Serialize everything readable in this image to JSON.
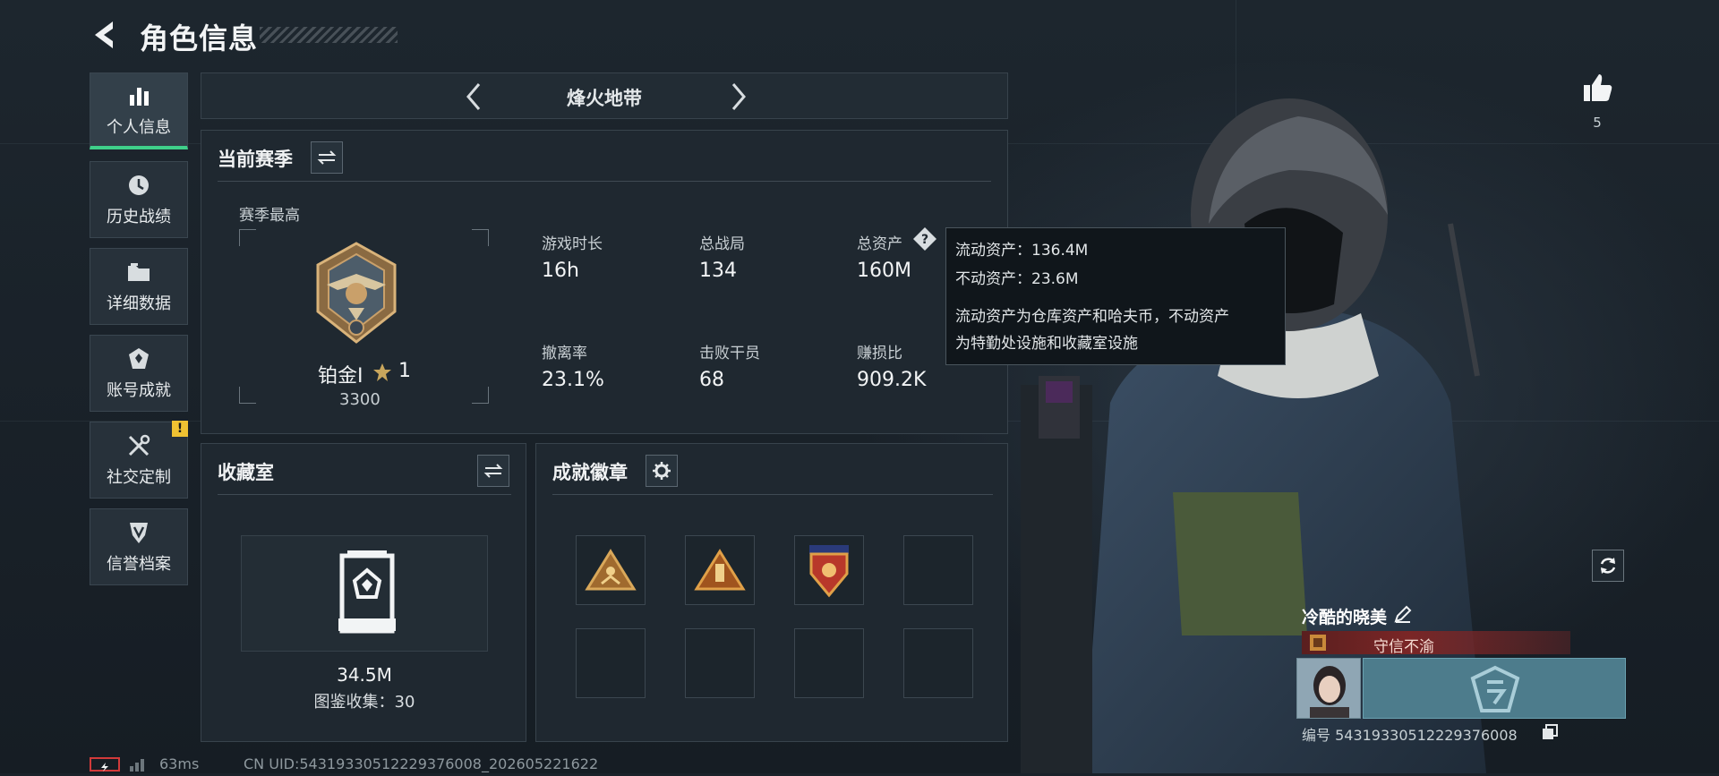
{
  "header": {
    "title": "角色信息"
  },
  "sidebar": {
    "items": [
      {
        "label": "个人信息",
        "icon": "bar-chart-icon",
        "active": true
      },
      {
        "label": "历史战绩",
        "icon": "history-icon"
      },
      {
        "label": "详细数据",
        "icon": "folder-icon"
      },
      {
        "label": "账号成就",
        "icon": "achievement-icon"
      },
      {
        "label": "社交定制",
        "icon": "tools-icon",
        "badge": "!"
      },
      {
        "label": "信誉档案",
        "icon": "shield-icon"
      }
    ]
  },
  "mode_selector": {
    "label": "烽火地带"
  },
  "current_season": {
    "title": "当前赛季",
    "season_best_label": "赛季最高",
    "rank_name": "铂金I",
    "rank_stars": "1",
    "rank_score": "3300",
    "stats": [
      {
        "label": "游戏时长",
        "value": "16h"
      },
      {
        "label": "总战局",
        "value": "134"
      },
      {
        "label": "总资产",
        "value": "160M"
      },
      {
        "label": "撤离率",
        "value": "23.1%"
      },
      {
        "label": "击败干员",
        "value": "68"
      },
      {
        "label": "赚损比",
        "value": "909.2K"
      }
    ]
  },
  "tooltip": {
    "line1": "流动资产：136.4M",
    "line2": "不动资产：23.6M",
    "line3": "流动资产为仓库资产和哈夫币，不动资产",
    "line4": "为特勤处设施和收藏室设施"
  },
  "collection": {
    "title": "收藏室",
    "value": "34.5M",
    "count_text": "图鉴收集：30"
  },
  "achievements": {
    "title": "成就徽章"
  },
  "likes": {
    "count": "5"
  },
  "player": {
    "name": "冷酷的晓美",
    "honor": "守信不渝",
    "uid_text": "编号 543193305122293760​08"
  },
  "footer": {
    "ping": "63ms",
    "uid": "CN UID:543193305122293760​08_202605221622"
  },
  "colors": {
    "accent_green": "#3fd08a",
    "warning": "#f0c232",
    "honor_red": "#7a2626"
  }
}
